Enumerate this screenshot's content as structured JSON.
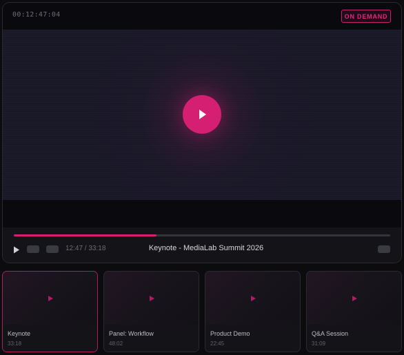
{
  "player": {
    "timecode": "00:12:47:04",
    "badge": "ON DEMAND",
    "progress_fraction": 0.38,
    "time_display": "12:47 / 33:18",
    "title": "Keynote - MediaLab Summit 2026",
    "accent_color": "#d41f72"
  },
  "playlist": [
    {
      "title": "Keynote",
      "duration": "33:18",
      "active": true
    },
    {
      "title": "Panel: Workflow",
      "duration": "48:02",
      "active": false
    },
    {
      "title": "Product Demo",
      "duration": "22:45",
      "active": false
    },
    {
      "title": "Q&A Session",
      "duration": "31:09",
      "active": false
    }
  ]
}
